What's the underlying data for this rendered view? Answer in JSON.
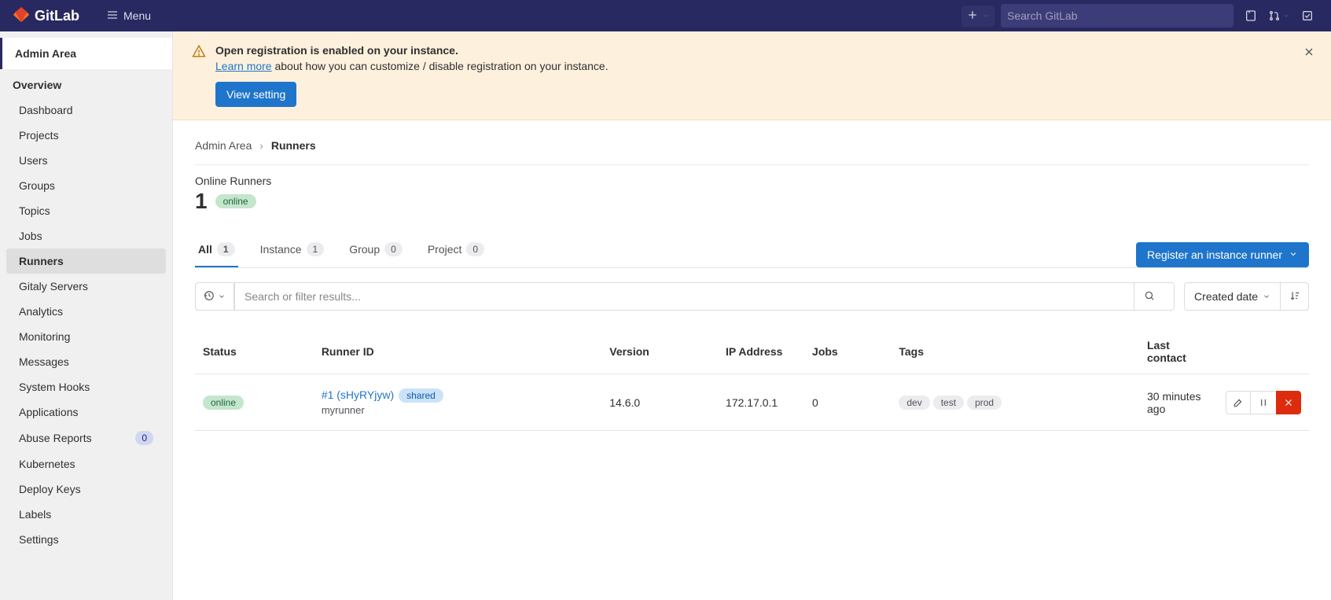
{
  "topnav": {
    "brand": "GitLab",
    "menu": "Menu",
    "search_placeholder": "Search GitLab"
  },
  "sidebar": {
    "title": "Admin Area",
    "section": "Overview",
    "items": [
      {
        "label": "Dashboard"
      },
      {
        "label": "Projects"
      },
      {
        "label": "Users"
      },
      {
        "label": "Groups"
      },
      {
        "label": "Topics"
      },
      {
        "label": "Jobs"
      },
      {
        "label": "Runners",
        "active": true
      },
      {
        "label": "Gitaly Servers"
      },
      {
        "label": "Analytics"
      },
      {
        "label": "Monitoring"
      },
      {
        "label": "Messages"
      },
      {
        "label": "System Hooks"
      },
      {
        "label": "Applications"
      },
      {
        "label": "Abuse Reports",
        "badge": "0"
      },
      {
        "label": "Kubernetes"
      },
      {
        "label": "Deploy Keys"
      },
      {
        "label": "Labels"
      },
      {
        "label": "Settings"
      }
    ]
  },
  "alert": {
    "title": "Open registration is enabled on your instance.",
    "link_text": "Learn more",
    "rest": " about how you can customize / disable registration on your instance.",
    "button": "View setting"
  },
  "breadcrumb": {
    "root": "Admin Area",
    "current": "Runners"
  },
  "summary": {
    "label": "Online Runners",
    "count": "1",
    "status": "online"
  },
  "tabs": [
    {
      "label": "All",
      "count": "1",
      "active": true
    },
    {
      "label": "Instance",
      "count": "1"
    },
    {
      "label": "Group",
      "count": "0"
    },
    {
      "label": "Project",
      "count": "0"
    }
  ],
  "register_button": "Register an instance runner",
  "filter": {
    "placeholder": "Search or filter results...",
    "sort": "Created date"
  },
  "table": {
    "headers": {
      "status": "Status",
      "runner_id": "Runner ID",
      "version": "Version",
      "ip": "IP Address",
      "jobs": "Jobs",
      "tags": "Tags",
      "last": "Last contact"
    },
    "rows": [
      {
        "status": "online",
        "id": "#1 (sHyRYjyw)",
        "type": "shared",
        "desc": "myrunner",
        "version": "14.6.0",
        "ip": "172.17.0.1",
        "jobs": "0",
        "tags": [
          "dev",
          "test",
          "prod"
        ],
        "last": "30 minutes ago"
      }
    ]
  }
}
